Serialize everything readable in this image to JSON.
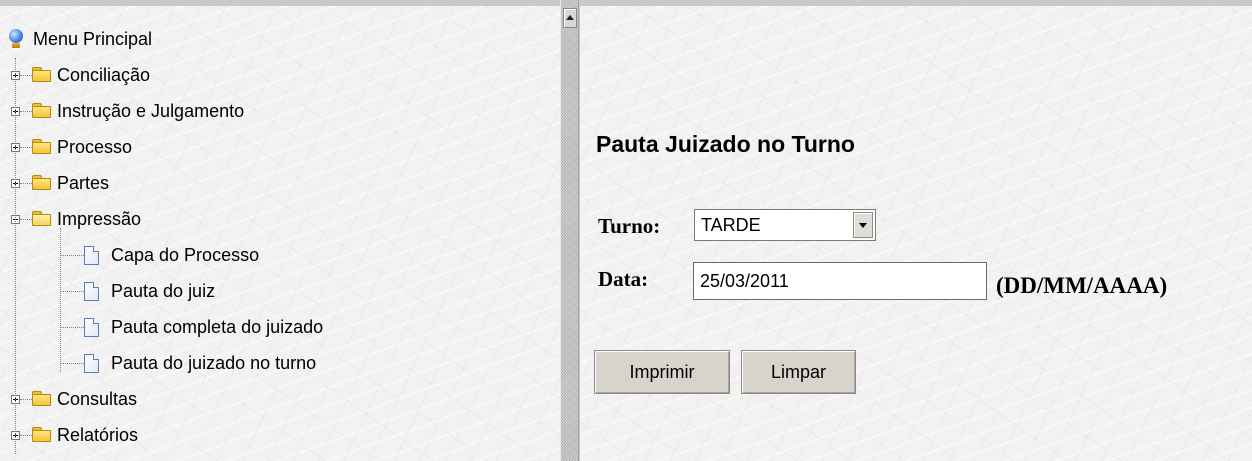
{
  "menu": {
    "root_label": "Menu Principal",
    "items": [
      {
        "label": "Conciliação",
        "state": "collapsed"
      },
      {
        "label": "Instrução e Julgamento",
        "state": "collapsed"
      },
      {
        "label": "Processo",
        "state": "collapsed"
      },
      {
        "label": "Partes",
        "state": "collapsed"
      },
      {
        "label": "Impressão",
        "state": "expanded",
        "children": [
          {
            "label": "Capa do Processo"
          },
          {
            "label": "Pauta do juiz"
          },
          {
            "label": "Pauta completa do juizado"
          },
          {
            "label": "Pauta do juizado no turno"
          }
        ]
      },
      {
        "label": "Consultas",
        "state": "collapsed"
      },
      {
        "label": "Relatórios",
        "state": "collapsed"
      }
    ]
  },
  "form": {
    "title": "Pauta Juizado no Turno",
    "turno_label": "Turno:",
    "turno_value": "TARDE",
    "data_label": "Data:",
    "data_value": "25/03/2011",
    "date_format_hint": "(DD/MM/AAAA)",
    "print_button": "Imprimir",
    "clear_button": "Limpar"
  },
  "icons": {
    "root": "globe-icon",
    "folder": "folder-icon",
    "document": "document-icon",
    "expander": "expand-toggle-icon"
  }
}
